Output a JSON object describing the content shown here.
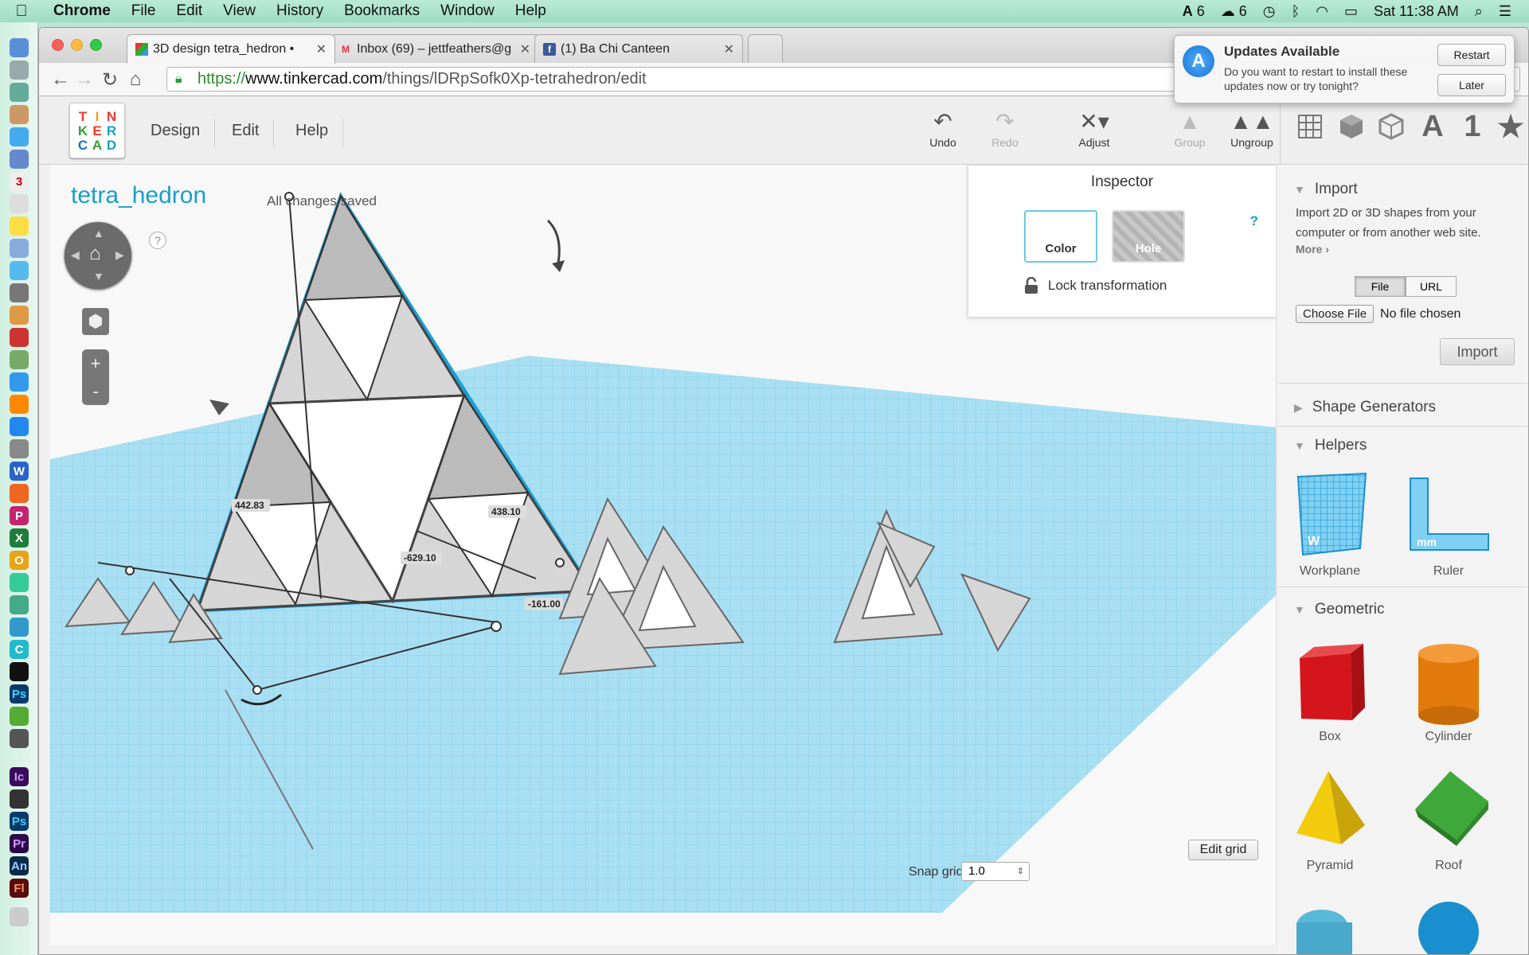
{
  "menubar": {
    "app": "Chrome",
    "items": [
      "File",
      "Edit",
      "View",
      "History",
      "Bookmarks",
      "Window",
      "Help"
    ],
    "adobe_count": "6",
    "cc_count": "6",
    "clock": "Sat 11:38 AM"
  },
  "tabs": [
    {
      "title": "3D design tetra_hedron •",
      "favicon": "tinkercad-icon"
    },
    {
      "title": "Inbox (69) – jettfeathers@g",
      "favicon": "gmail-icon"
    },
    {
      "title": "(1) Ba Chi Canteen",
      "favicon": "facebook-icon"
    }
  ],
  "url": {
    "scheme": "https://",
    "host": "www.tinkercad.com",
    "path": "/things/lDRpSofk0Xp-tetrahedron/edit"
  },
  "tinkercad": {
    "logo": [
      "T",
      "I",
      "N",
      "K",
      "E",
      "R",
      "C",
      "A",
      "D"
    ],
    "menu": [
      "Design",
      "Edit",
      "Help"
    ],
    "tools": [
      {
        "label": "Undo",
        "enabled": true
      },
      {
        "label": "Redo",
        "enabled": false
      },
      {
        "label": "Adjust",
        "enabled": true
      },
      {
        "label": "Group",
        "enabled": false
      },
      {
        "label": "Ungroup",
        "enabled": true
      }
    ],
    "shape_tabs": [
      "A",
      "1",
      "★"
    ]
  },
  "viewport": {
    "design_title": "tetra_hedron",
    "save_status": "All changes saved",
    "help": "?",
    "zoom_in": "+",
    "zoom_out": "-",
    "dimensions": [
      "442.83",
      "438.10",
      "-629.10",
      "-161.00"
    ],
    "edit_grid": "Edit grid",
    "snap_label": "Snap grid",
    "snap_value": "1.0"
  },
  "inspector": {
    "title": "Inspector",
    "color": "Color",
    "hole": "Hole",
    "lock": "Lock transformation",
    "help": "?"
  },
  "panel": {
    "import": {
      "title": "Import",
      "desc": "Import 2D or 3D shapes from your computer or from another web site.",
      "more": "More ›",
      "file": "File",
      "url": "URL",
      "choose": "Choose File",
      "no_file": "No file chosen",
      "button": "Import"
    },
    "shape_generators": "Shape Generators",
    "helpers": {
      "title": "Helpers",
      "items": [
        "Workplane",
        "Ruler"
      ]
    },
    "geometric": {
      "title": "Geometric",
      "items": [
        "Box",
        "Cylinder",
        "Pyramid",
        "Roof"
      ]
    }
  },
  "notification": {
    "title": "Updates Available",
    "message": "Do you want to restart to install these updates now or try tonight?",
    "restart": "Restart",
    "later": "Later"
  },
  "colors": {
    "tinkercad_blue": "#1a9fc6",
    "grid_blue": "#8fd3ee",
    "box_red": "#d4161c",
    "cylinder_orange": "#e37b0c",
    "pyramid_yellow": "#f2cb0d",
    "roof_green": "#3fa83a"
  }
}
